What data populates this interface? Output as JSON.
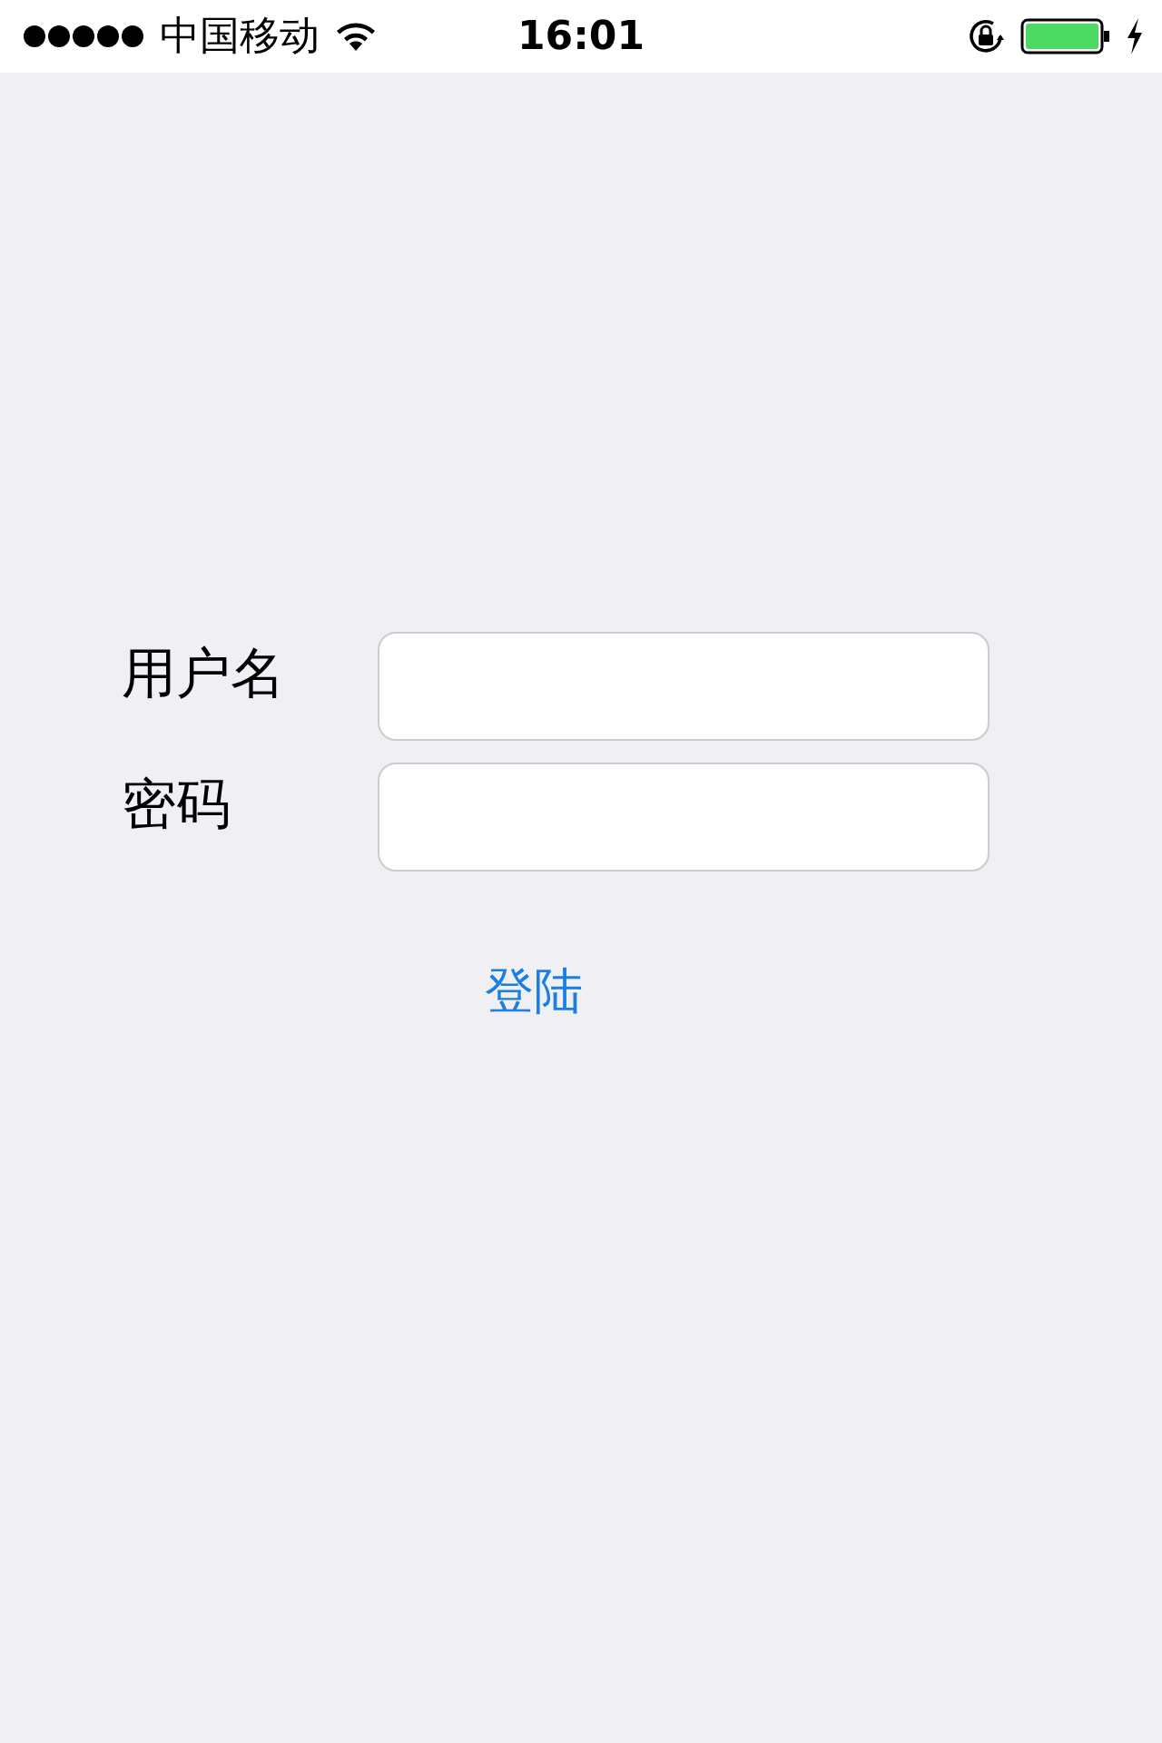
{
  "status_bar": {
    "carrier": "中国移动",
    "time": "16:01"
  },
  "fields": [
    {
      "label": "用户名"
    },
    {
      "label": "密码"
    }
  ],
  "login_button": {
    "label": "登陆"
  }
}
